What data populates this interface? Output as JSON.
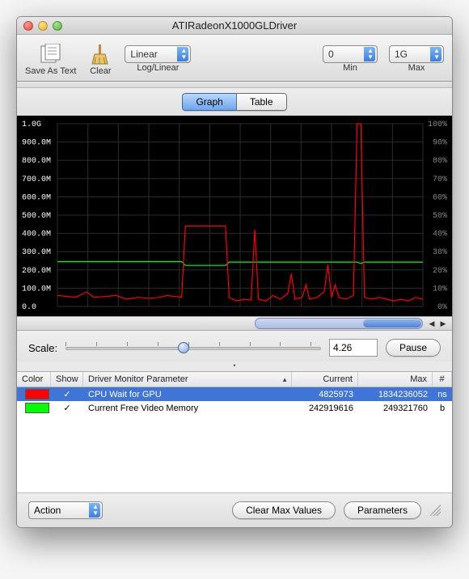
{
  "window": {
    "title": "ATIRadeonX1000GLDriver"
  },
  "toolbar": {
    "save_label": "Save As Text",
    "clear_label": "Clear",
    "loglinear_label": "Log/Linear",
    "loglinear_value": "Linear",
    "min_label": "Min",
    "min_value": "0",
    "max_label": "Max",
    "max_value": "1G"
  },
  "tabs": {
    "graph": "Graph",
    "table": "Table",
    "active": "graph"
  },
  "graph": {
    "y_left": [
      "1.0G",
      "900.0M",
      "800.0M",
      "700.0M",
      "600.0M",
      "500.0M",
      "400.0M",
      "300.0M",
      "200.0M",
      "100.0M",
      "0.0"
    ],
    "y_right": [
      "100%",
      "90%",
      "80%",
      "70%",
      "60%",
      "50%",
      "40%",
      "30%",
      "20%",
      "10%",
      "0%"
    ]
  },
  "chart_data": {
    "type": "line",
    "title": "",
    "xlabel": "",
    "ylabel": "",
    "ylim_left": [
      0,
      1000000000
    ],
    "ylim_right_pct": [
      0,
      100
    ],
    "x_range": [
      0,
      100
    ],
    "series": [
      {
        "name": "CPU Wait for GPU",
        "color": "#ff0000",
        "unit": "ns",
        "points": [
          [
            0,
            60000000
          ],
          [
            3,
            55000000
          ],
          [
            5,
            50000000
          ],
          [
            8,
            80000000
          ],
          [
            10,
            50000000
          ],
          [
            13,
            55000000
          ],
          [
            16,
            60000000
          ],
          [
            19,
            40000000
          ],
          [
            22,
            50000000
          ],
          [
            25,
            45000000
          ],
          [
            28,
            50000000
          ],
          [
            30,
            60000000
          ],
          [
            32,
            55000000
          ],
          [
            34,
            50000000
          ],
          [
            35,
            440000000
          ],
          [
            36,
            440000000
          ],
          [
            38,
            440000000
          ],
          [
            40,
            440000000
          ],
          [
            42,
            440000000
          ],
          [
            44,
            440000000
          ],
          [
            46,
            440000000
          ],
          [
            47,
            50000000
          ],
          [
            49,
            30000000
          ],
          [
            51,
            40000000
          ],
          [
            53,
            35000000
          ],
          [
            54,
            420000000
          ],
          [
            55,
            40000000
          ],
          [
            57,
            30000000
          ],
          [
            59,
            60000000
          ],
          [
            61,
            40000000
          ],
          [
            63,
            70000000
          ],
          [
            64,
            180000000
          ],
          [
            65,
            40000000
          ],
          [
            67,
            50000000
          ],
          [
            68,
            120000000
          ],
          [
            69,
            40000000
          ],
          [
            71,
            50000000
          ],
          [
            73,
            80000000
          ],
          [
            74,
            230000000
          ],
          [
            75,
            50000000
          ],
          [
            76,
            120000000
          ],
          [
            77,
            50000000
          ],
          [
            79,
            40000000
          ],
          [
            81,
            60000000
          ],
          [
            82,
            1000000000
          ],
          [
            83,
            1000000000
          ],
          [
            84,
            50000000
          ],
          [
            86,
            40000000
          ],
          [
            88,
            50000000
          ],
          [
            90,
            40000000
          ],
          [
            92,
            30000000
          ],
          [
            94,
            40000000
          ],
          [
            96,
            30000000
          ],
          [
            98,
            50000000
          ],
          [
            100,
            40000000
          ]
        ]
      },
      {
        "name": "Current Free Video Memory",
        "color": "#00ff00",
        "unit": "b",
        "points": [
          [
            0,
            245000000
          ],
          [
            10,
            245000000
          ],
          [
            20,
            245000000
          ],
          [
            30,
            245000000
          ],
          [
            34,
            245000000
          ],
          [
            35,
            225000000
          ],
          [
            46,
            225000000
          ],
          [
            47,
            243000000
          ],
          [
            60,
            243000000
          ],
          [
            70,
            243000000
          ],
          [
            82,
            243000000
          ],
          [
            83,
            235000000
          ],
          [
            84,
            243000000
          ],
          [
            100,
            243000000
          ]
        ]
      }
    ]
  },
  "scale": {
    "label": "Scale:",
    "value": "4.26",
    "pause_label": "Pause"
  },
  "table": {
    "headers": {
      "color": "Color",
      "show": "Show",
      "param": "Driver Monitor Parameter",
      "current": "Current",
      "max": "Max",
      "unit": "#"
    },
    "rows": [
      {
        "color": "#ff0000",
        "show": "✓",
        "param": "CPU Wait for GPU",
        "current": "4825973",
        "max": "1834236052",
        "unit": "ns",
        "selected": true
      },
      {
        "color": "#00ff00",
        "show": "✓",
        "param": "Current Free Video Memory",
        "current": "242919616",
        "max": "249321760",
        "unit": "b",
        "selected": false
      }
    ]
  },
  "footer": {
    "action_label": "Action",
    "clearmax_label": "Clear Max Values",
    "params_label": "Parameters"
  }
}
